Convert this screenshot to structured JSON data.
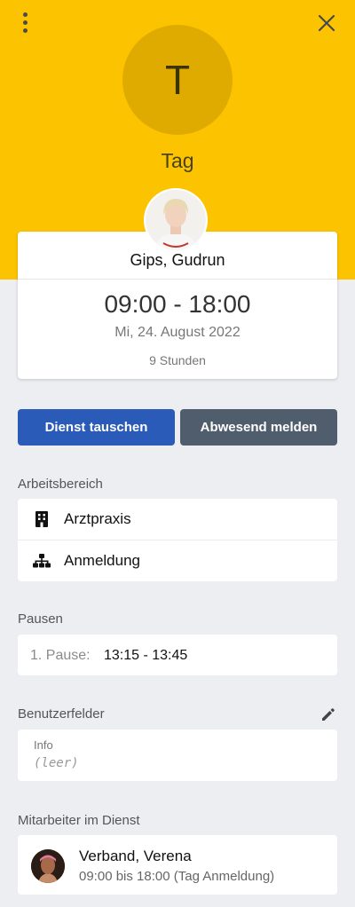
{
  "header": {
    "avatar_letter": "T",
    "shift_name": "Tag",
    "background_color": "#fcc300",
    "icons": [
      "more-vertical-icon",
      "close-icon"
    ]
  },
  "shift_card": {
    "employee_name": "Gips, Gudrun",
    "time_range": "09:00 - 18:00",
    "date": "Mi, 24. August 2022",
    "duration": "9 Stunden"
  },
  "actions": {
    "swap_label": "Dienst tauschen",
    "absent_label": "Abwesend melden",
    "swap_color": "#2b5bb8",
    "absent_color": "#505d6c"
  },
  "work_area": {
    "title": "Arbeitsbereich",
    "items": [
      {
        "icon": "building-icon",
        "label": "Arztpraxis"
      },
      {
        "icon": "sitemap-icon",
        "label": "Anmeldung"
      }
    ]
  },
  "breaks": {
    "title": "Pausen",
    "label": "1. Pause:",
    "value": "13:15 - 13:45"
  },
  "user_fields": {
    "title": "Benutzerfelder",
    "field_label": "Info",
    "field_value": "(leer)"
  },
  "coworkers": {
    "title": "Mitarbeiter im Dienst",
    "items": [
      {
        "name": "Verband, Verena",
        "detail": "09:00 bis 18:00 (Tag Anmeldung)"
      }
    ]
  }
}
